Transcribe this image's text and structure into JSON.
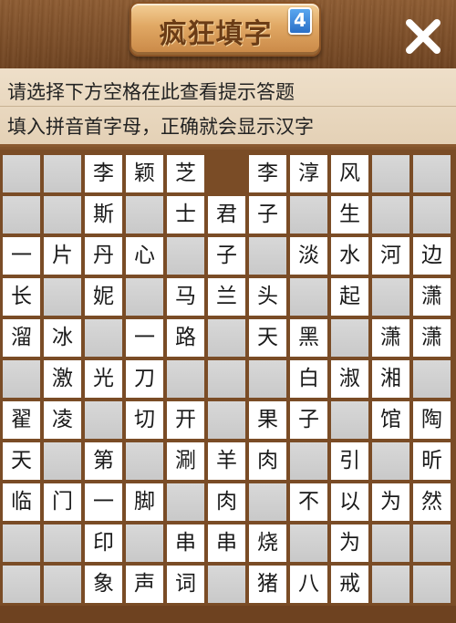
{
  "header": {
    "title": "疯狂填字",
    "badge": "4",
    "close_icon": "close-x-icon"
  },
  "hints": {
    "line1": "请选择下方空格在此查看提示答题",
    "line2": "填入拼音首字母，正确就会显示汉字"
  },
  "colors": {
    "background": "#7a4c26",
    "empty_cell": "#cdcdcd",
    "filled_cell": "#ffffff",
    "hint_bar": "#e8d8c0",
    "badge": "#2a6fc6"
  },
  "grid": {
    "rows": 11,
    "cols": 11,
    "cells": [
      [
        "",
        "",
        "李",
        "颖",
        "芝",
        null,
        "李",
        "淳",
        "风",
        "",
        ""
      ],
      [
        "",
        "",
        "斯",
        "",
        "士",
        "君",
        "子",
        "",
        "生",
        "",
        ""
      ],
      [
        "一",
        "片",
        "丹",
        "心",
        "",
        "子",
        "",
        "淡",
        "水",
        "河",
        "边"
      ],
      [
        "长",
        "",
        "妮",
        "",
        "马",
        "兰",
        "头",
        "",
        "起",
        "",
        "潇"
      ],
      [
        "溜",
        "冰",
        "",
        "一",
        "路",
        "",
        "天",
        "黑",
        "",
        "潇",
        "潇"
      ],
      [
        "",
        "激",
        "光",
        "刀",
        "",
        "",
        "",
        "白",
        "淑",
        "湘",
        ""
      ],
      [
        "翟",
        "凌",
        "",
        "切",
        "开",
        "",
        "果",
        "子",
        "",
        "馆",
        "陶"
      ],
      [
        "天",
        "",
        "第",
        "",
        "涮",
        "羊",
        "肉",
        "",
        "引",
        "",
        "昕"
      ],
      [
        "临",
        "门",
        "一",
        "脚",
        "",
        "肉",
        "",
        "不",
        "以",
        "为",
        "然"
      ],
      [
        "",
        "",
        "印",
        "",
        "串",
        "串",
        "烧",
        "",
        "为",
        "",
        ""
      ],
      [
        "",
        "",
        "象",
        "声",
        "词",
        "",
        "猪",
        "八",
        "戒",
        "",
        ""
      ]
    ]
  }
}
